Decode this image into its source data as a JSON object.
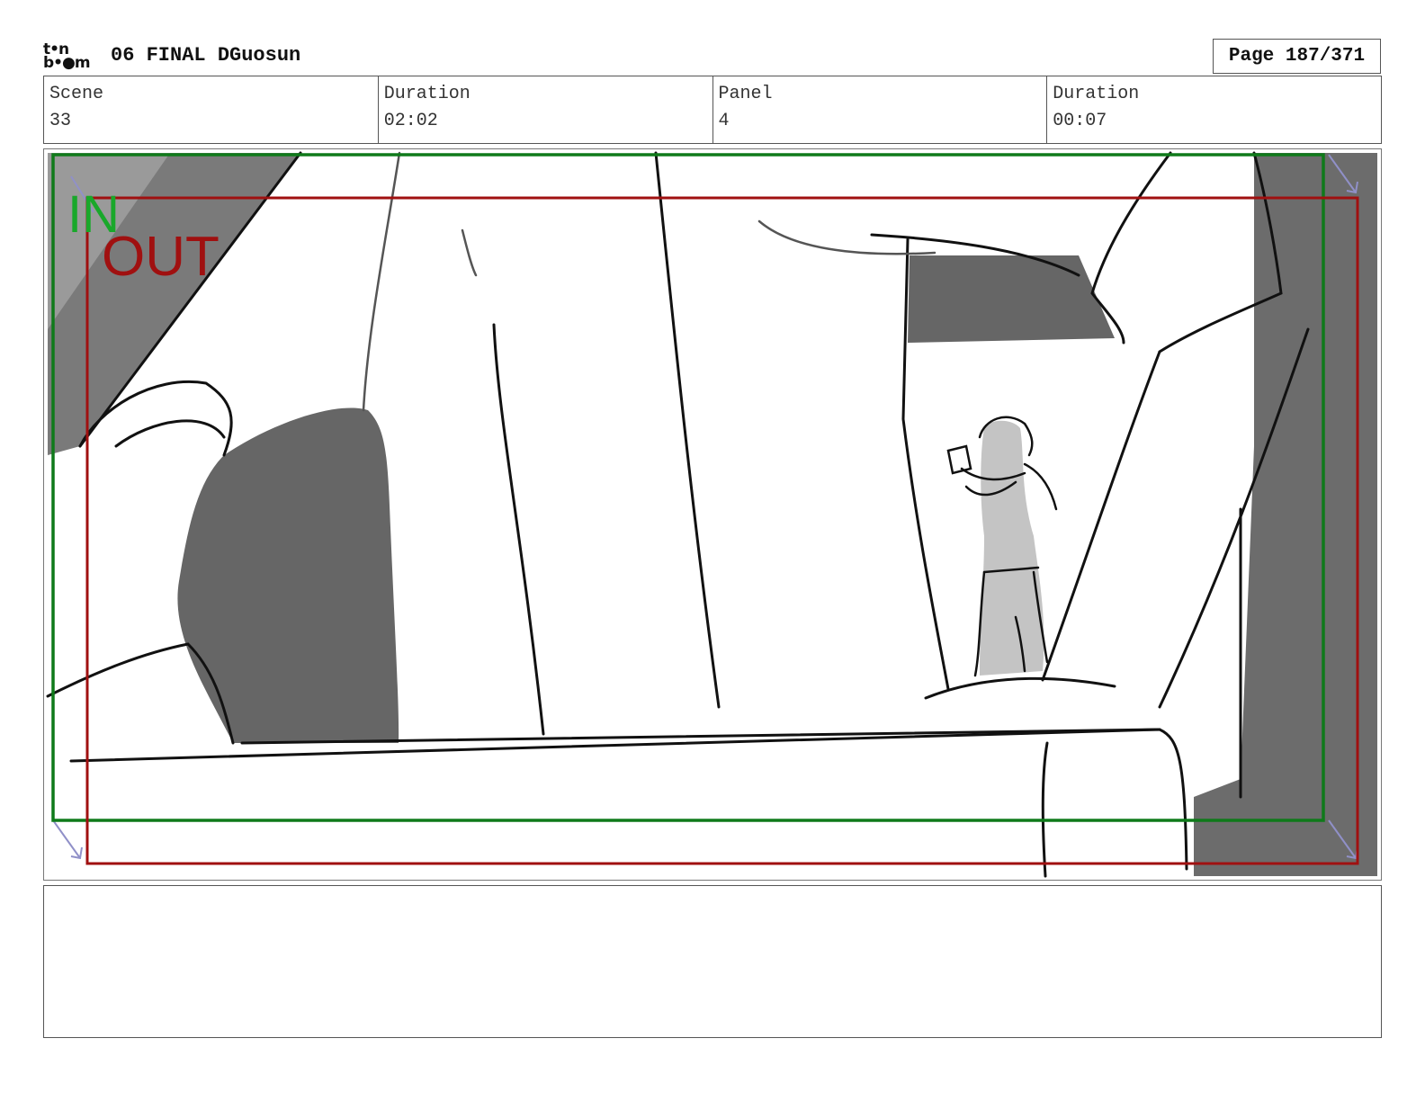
{
  "header": {
    "logo_top": "t•n",
    "logo_bottom": "b•●m",
    "project_title": "06 FINAL DGuosun",
    "page_label": "Page 187/371"
  },
  "info": {
    "scene_label": "Scene",
    "scene_value": "33",
    "scene_duration_label": "Duration",
    "scene_duration_value": "02:02",
    "panel_label": "Panel",
    "panel_value": "4",
    "panel_duration_label": "Duration",
    "panel_duration_value": "00:07"
  },
  "frame": {
    "in_label": "IN",
    "out_label": "OUT",
    "in_color": "#0f7a1a",
    "out_color": "#a01010"
  },
  "notes": {
    "text": ""
  }
}
